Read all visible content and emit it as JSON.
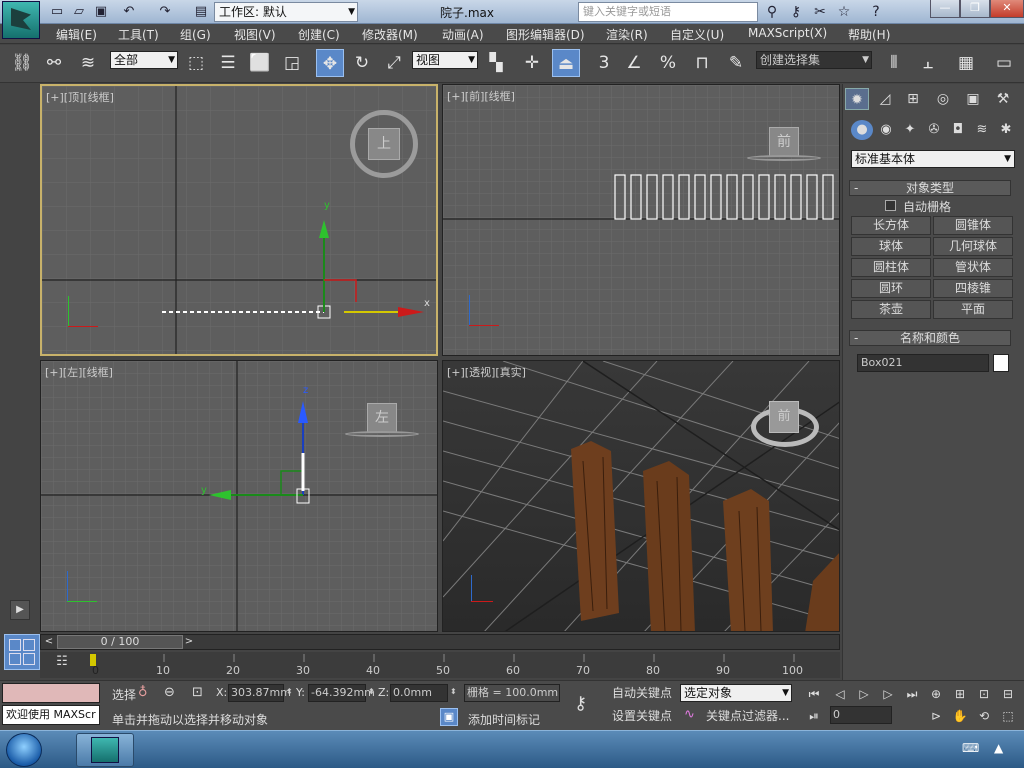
{
  "titlebar": {
    "workspace": "工作区: 默认",
    "file_name": "院子.max",
    "search_placeholder": "键入关键字或短语"
  },
  "menu": [
    "编辑(E)",
    "工具(T)",
    "组(G)",
    "视图(V)",
    "创建(C)",
    "修改器(M)",
    "动画(A)",
    "图形编辑器(D)",
    "渲染(R)",
    "自定义(U)",
    "MAXScript(X)",
    "帮助(H)"
  ],
  "toolbar": {
    "selection_filter": "全部",
    "ref_coord": "视图",
    "named_selection": "创建选择集",
    "snap_label": "3"
  },
  "viewports": {
    "top": {
      "label": "[+][顶][线框]",
      "cube_face": "上"
    },
    "front": {
      "label": "[+][前][线框]",
      "cube_face": "前"
    },
    "left": {
      "label": "[+][左][线框]",
      "cube_face": "左"
    },
    "persp": {
      "label": "[+][透视][真实]",
      "cube_face": "前"
    }
  },
  "command_panel": {
    "category": "标准基本体",
    "object_type_title": "对象类型",
    "autogrid": "自动栅格",
    "objects": [
      "长方体",
      "圆锥体",
      "球体",
      "几何球体",
      "圆柱体",
      "管状体",
      "圆环",
      "四棱锥",
      "茶壶",
      "平面"
    ],
    "name_color_title": "名称和颜色",
    "object_name": "Box021",
    "object_color": "#ffffff"
  },
  "timeline": {
    "frame_display": "0 / 100",
    "ticks": [
      "0",
      "10",
      "20",
      "30",
      "40",
      "50",
      "60",
      "70",
      "80",
      "90",
      "100"
    ]
  },
  "status": {
    "maxscript": "欢迎使用 MAXScr",
    "selected_label": "选择",
    "x_label": "X:",
    "x_value": "303.87mm",
    "y_label": "Y:",
    "y_value": "-64.392mm",
    "z_label": "Z:",
    "z_value": "0.0mm",
    "grid": "栅格 = 100.0mm",
    "prompt": "单击并拖动以选择并移动对象",
    "add_time_tag": "添加时间标记",
    "auto_key": "自动关键点",
    "set_key": "设置关键点",
    "key_filter_target": "选定对象",
    "key_filters": "关键点过滤器...",
    "current_frame": "0"
  }
}
